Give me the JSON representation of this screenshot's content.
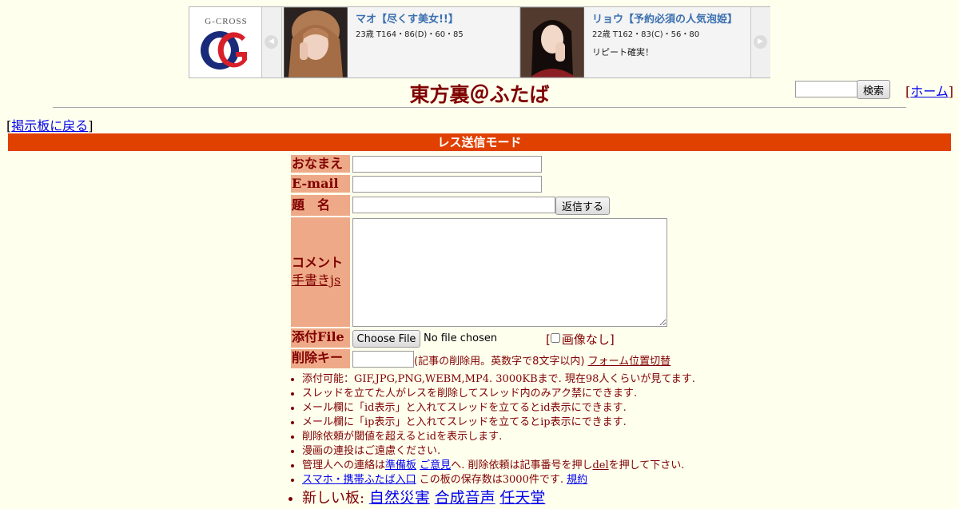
{
  "banner": {
    "logo_text": "G-CROSS",
    "prev_icon": "chevron-left-icon",
    "next_icon": "chevron-right-icon",
    "cards": [
      {
        "name": "マオ【尽くす美女!!】",
        "stats": "23歳 T164・86(D)・60・85",
        "note": ""
      },
      {
        "name": "リョウ【予約必須の人気泡姫】",
        "stats": "22歳 T162・83(C)・56・80",
        "note": "リピート確実！"
      }
    ]
  },
  "header": {
    "title": "東方裏＠ふたば",
    "search_button": "検索",
    "home_prefix": "[",
    "home_link": "ホーム",
    "home_suffix": "]"
  },
  "back": {
    "prefix": "[",
    "link": "掲示板に戻る",
    "suffix": "]"
  },
  "mode_bar": "レス送信モード",
  "form": {
    "name_label": "おなまえ",
    "email_label": "E-mail",
    "subject_label": "題　名",
    "submit_label": "返信する",
    "comment_label": "コメント",
    "handwrite_link": "手書きjs",
    "file_label": "添付File",
    "choose_file": "Choose File",
    "file_status": "No file chosen",
    "no_image_open": "[",
    "no_image_label": "画像なし",
    "no_image_close": "]",
    "delkey_label": "削除キー",
    "delkey_note": "(記事の削除用。英数字で8文字以内)",
    "form_position_link": "フォーム位置切替"
  },
  "rules": {
    "r1": "添付可能：GIF,JPG,PNG,WEBM,MP4. 3000KBまで. 現在98人くらいが見てます.",
    "r2": "スレッドを立てた人がレスを削除してスレッド内のみアク禁にできます.",
    "r3": "メール欄に「id表示」と入れてスレッドを立てるとid表示にできます.",
    "r4": "メール欄に「ip表示」と入れてスレッドを立てるとip表示にできます.",
    "r5": "削除依頼が閾値を超えるとidを表示します.",
    "r6": "漫画の連投はご遠慮ください.",
    "r7_pre": "管理人への連絡は",
    "r7_link1": "準備板",
    "r7_link2": "ご意見",
    "r7_mid": "へ. 削除依頼は記事番号を押し",
    "r7_del": "del",
    "r7_post": "を押して下さい.",
    "r8_link": "スマホ・携帯ふたば入口",
    "r8_text": "この板の保存数は3000件です.",
    "r8_link2": "規約",
    "r9_label": "新しい板:",
    "r9_links": [
      "自然災害",
      "合成音声",
      "任天堂"
    ]
  }
}
